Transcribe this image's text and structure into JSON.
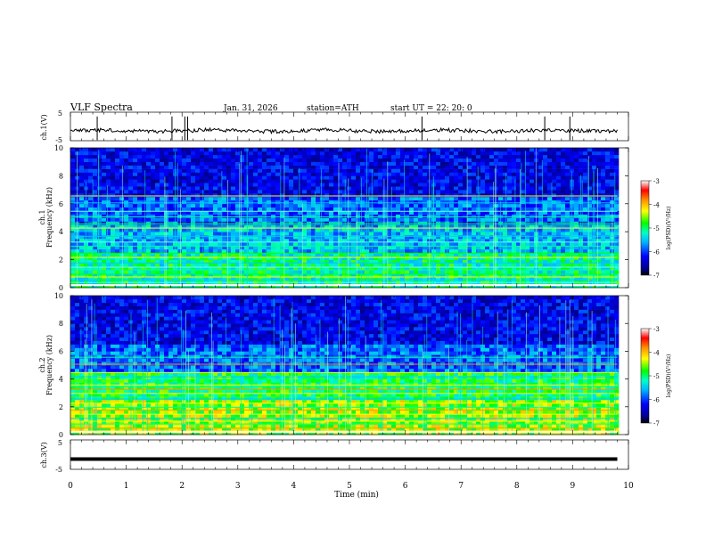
{
  "header": {
    "title": "VLF  Spectra",
    "date": "Jan. 31, 2026",
    "station": "station=ATH",
    "start": "start  UT  =   22: 20: 0"
  },
  "chart_data": [
    {
      "type": "line",
      "panel": "ch1-waveform",
      "ylabel": "ch.1(V)",
      "ylim": [
        -5,
        5
      ],
      "yticks": [
        "5",
        "-5"
      ],
      "xlim": [
        0,
        10
      ],
      "trace_end_min": 9.8,
      "baseline_v": -1.5,
      "spikes_min": [
        0.48,
        1.82,
        2.05,
        2.1,
        6.3,
        8.5,
        8.95
      ]
    },
    {
      "type": "heatmap",
      "panel": "ch1-spectrogram",
      "ylabel": "ch.1\nFrequency  (kHz)",
      "ylim": [
        0,
        10
      ],
      "yticks": [
        "0",
        "2",
        "4",
        "6",
        "8",
        "10"
      ],
      "xlim": [
        0,
        10
      ],
      "data_end_min": 9.8,
      "colorbar": {
        "label": "log(PSD)(V²/Hz)",
        "range": [
          -7,
          -3
        ],
        "ticks": [
          "-3",
          "-4",
          "-5",
          "-6",
          "-7"
        ]
      }
    },
    {
      "type": "heatmap",
      "panel": "ch2-spectrogram",
      "ylabel": "ch.2\nFrequency  (kHz)",
      "ylim": [
        0,
        10
      ],
      "yticks": [
        "0",
        "2",
        "4",
        "6",
        "8",
        "10"
      ],
      "xlim": [
        0,
        10
      ],
      "data_end_min": 9.8,
      "colorbar": {
        "label": "log(PSD)(V²/Hz)",
        "range": [
          -7,
          -3
        ],
        "ticks": [
          "-3",
          "-4",
          "-5",
          "-6",
          "-7"
        ]
      }
    },
    {
      "type": "line",
      "panel": "ch3-waveform",
      "ylabel": "ch.3(V)",
      "ylim": [
        -5,
        5
      ],
      "yticks": [
        "5",
        "-5"
      ],
      "xlim": [
        0,
        10
      ],
      "trace_end_min": 9.8,
      "baseline_v": -1.5,
      "xlabel": "Time  (min)",
      "xticks": [
        "0",
        "1",
        "2",
        "3",
        "4",
        "5",
        "6",
        "7",
        "8",
        "9",
        "10"
      ]
    }
  ]
}
